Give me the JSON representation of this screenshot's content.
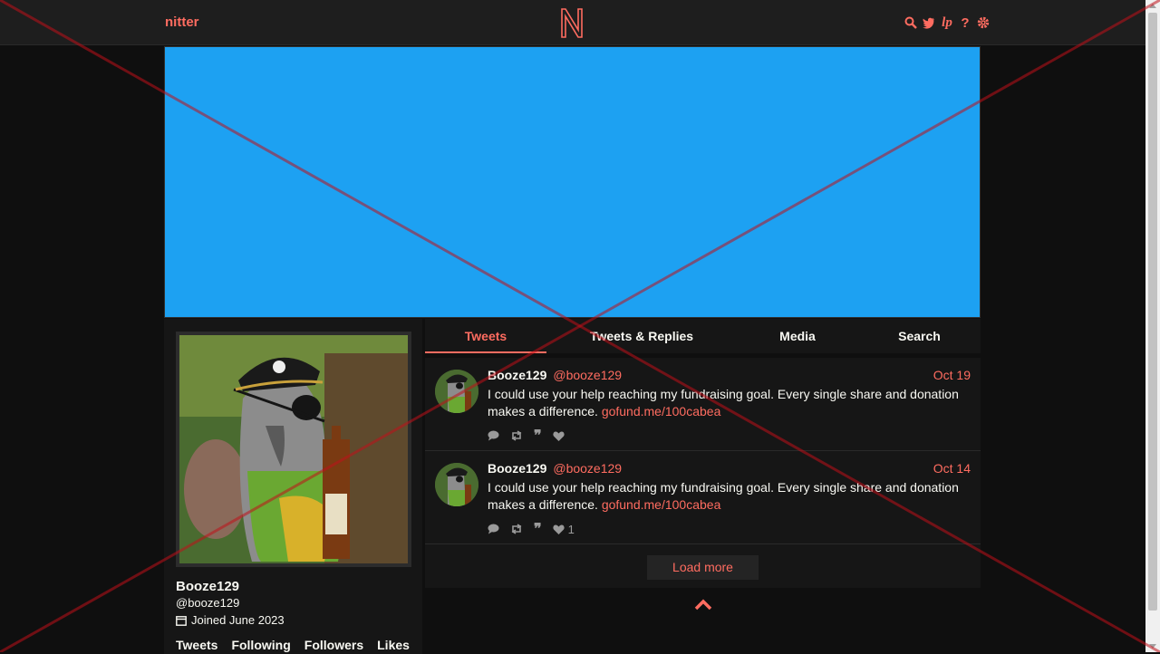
{
  "navbar": {
    "brand": "nitter",
    "icons": [
      "search-icon",
      "twitter-bird-icon",
      "rss-icon",
      "help-icon",
      "gear-icon"
    ]
  },
  "profile": {
    "fullname": "Booze129",
    "username": "@booze129",
    "joined": "Joined June 2023",
    "stats": [
      "Tweets",
      "Following",
      "Followers",
      "Likes"
    ]
  },
  "timeline": {
    "tabs": [
      "Tweets",
      "Tweets & Replies",
      "Media",
      "Search"
    ],
    "active_tab": "Tweets",
    "tweets": [
      {
        "fullname": "Booze129",
        "username": "@booze129",
        "date": "Oct 19",
        "text": "I could use your help reaching my fundraising goal. Every single share and donation makes a difference. ",
        "link": "gofund.me/100cabea",
        "likes": ""
      },
      {
        "fullname": "Booze129",
        "username": "@booze129",
        "date": "Oct 14",
        "text": "I could use your help reaching my fundraising goal. Every single share and donation makes a difference. ",
        "link": "gofund.me/100cabea",
        "likes": "1"
      }
    ],
    "load_more": "Load more"
  },
  "colors": {
    "accent": "#ff6c60",
    "banner": "#1da1f2",
    "background": "#0f0f0f",
    "panel": "#161616"
  }
}
